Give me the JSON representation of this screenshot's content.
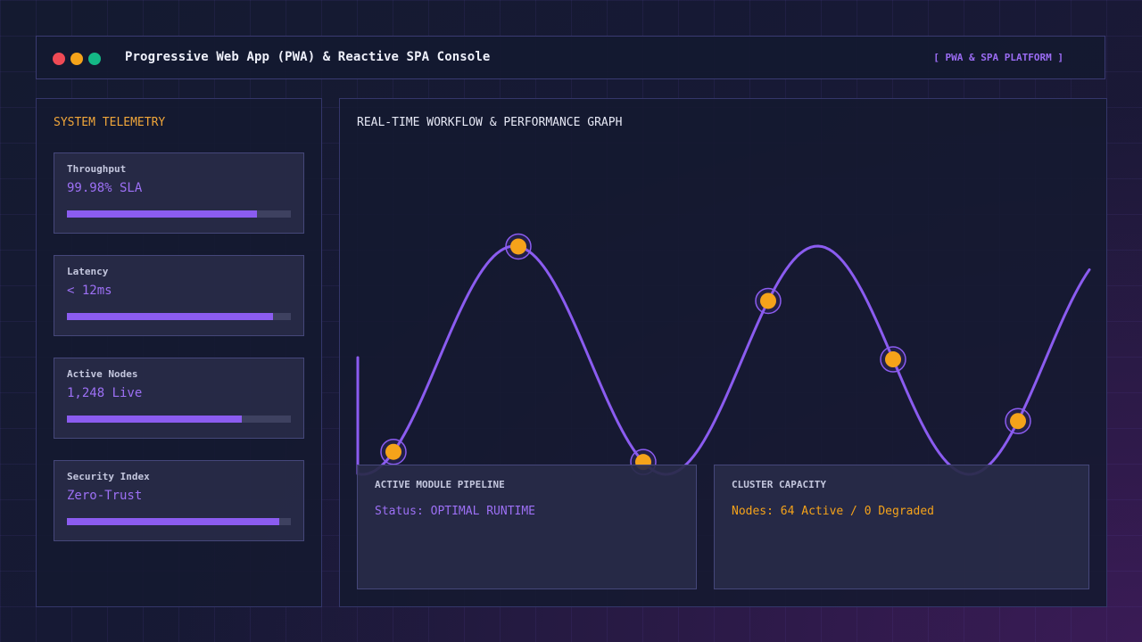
{
  "window": {
    "title": "Progressive Web App (PWA) & Reactive SPA Console",
    "badge": "[ PWA & SPA PLATFORM ]",
    "controls": [
      {
        "name": "close",
        "color": "#ef4a55"
      },
      {
        "name": "minimize",
        "color": "#f5a31a"
      },
      {
        "name": "maximize",
        "color": "#14b886"
      }
    ]
  },
  "telemetry": {
    "title": "SYSTEM TELEMETRY",
    "metrics": [
      {
        "label": "Throughput",
        "value": "99.98% SLA",
        "level": 0.85
      },
      {
        "label": "Latency",
        "value": "< 12ms",
        "level": 0.92
      },
      {
        "label": "Active Nodes",
        "value": "1,248 Live",
        "level": 0.78
      },
      {
        "label": "Security Index",
        "value": "Zero-Trust",
        "level": 0.95
      }
    ]
  },
  "graph": {
    "title": "REAL-TIME WORKFLOW & PERFORMANCE GRAPH",
    "colors": {
      "line": "#8b5cf0",
      "marker": "#f5a31a",
      "marker_ring": "#8b5cf0"
    }
  },
  "pipeline": {
    "title": "ACTIVE MODULE PIPELINE",
    "status": "Status: OPTIMAL RUNTIME",
    "status_color": "#9d70f5"
  },
  "cluster": {
    "title": "CLUSTER CAPACITY",
    "status": "Nodes: 64 Active / 0 Degraded",
    "status_color": "#f5a31a"
  }
}
